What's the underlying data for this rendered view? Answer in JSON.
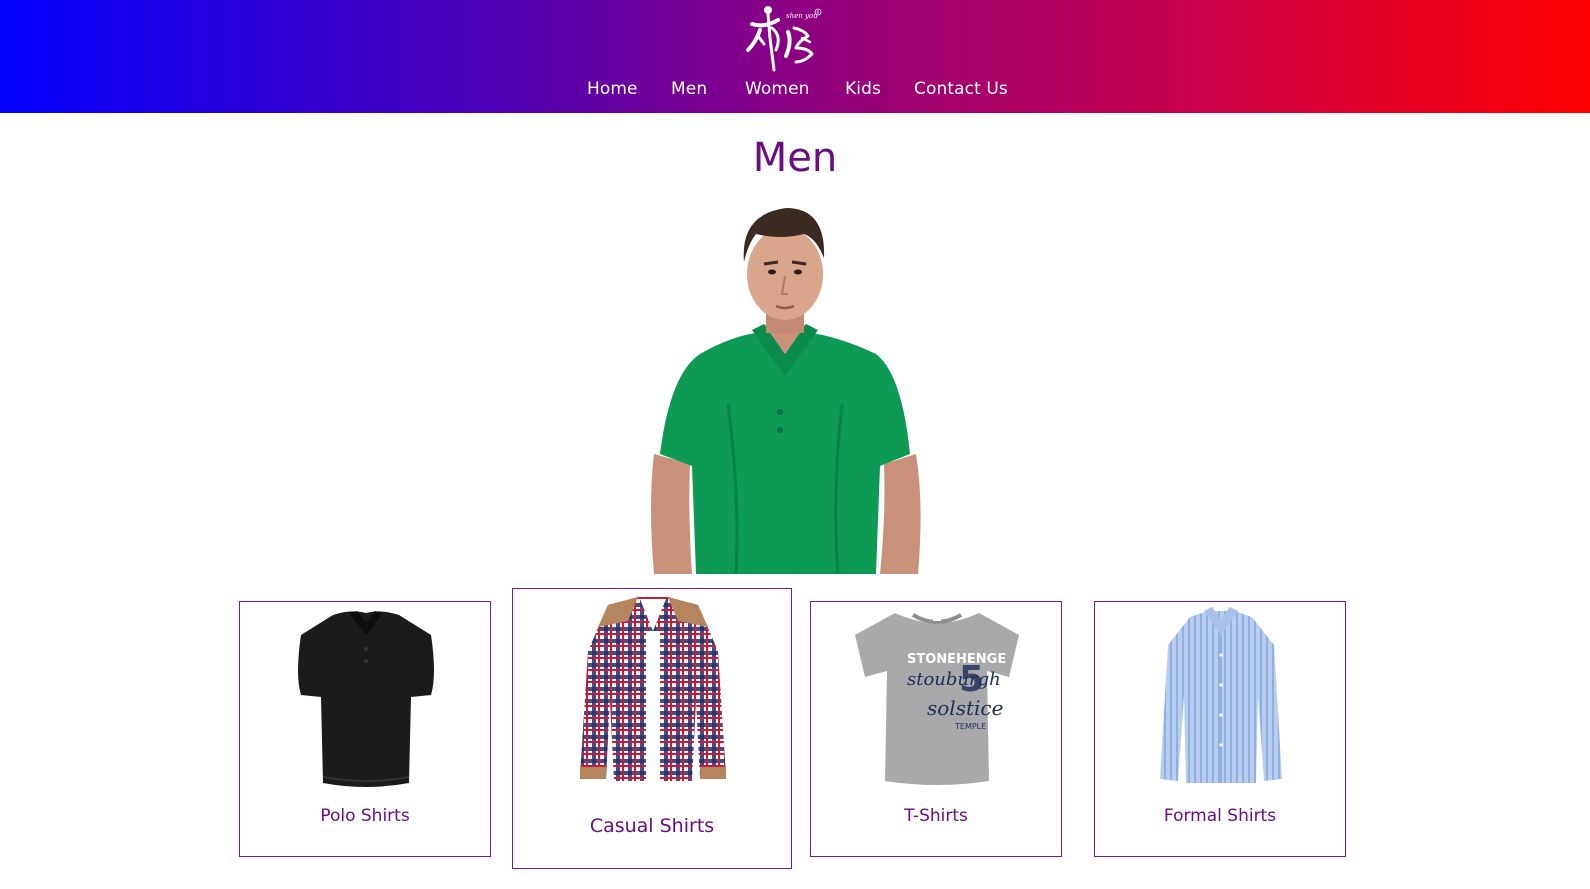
{
  "header": {
    "logo_alt": "shen you",
    "nav": [
      {
        "label": "Home"
      },
      {
        "label": "Men"
      },
      {
        "label": "Women"
      },
      {
        "label": "Kids"
      },
      {
        "label": "Contact Us"
      }
    ]
  },
  "page": {
    "title": "Men",
    "hero_alt": "Man in green polo shirt"
  },
  "categories": [
    {
      "label": "Polo Shirts",
      "icon": "black-polo-shirt"
    },
    {
      "label": "Casual Shirts",
      "icon": "checked-casual-shirt"
    },
    {
      "label": "T-Shirts",
      "icon": "grey-t-shirt"
    },
    {
      "label": "Formal Shirts",
      "icon": "blue-formal-shirt"
    }
  ],
  "colors": {
    "gradient_start": "#0400ff",
    "gradient_end": "#ff0000",
    "accent": "#6c0d80",
    "card_border": "#7d1a8a"
  }
}
